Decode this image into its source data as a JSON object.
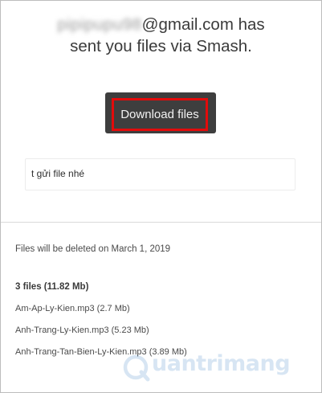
{
  "header": {
    "sender_email_blurred": "pipipupu98",
    "sender_email_domain": "@gmail.com has",
    "line2": "sent you files via Smash."
  },
  "actions": {
    "download_label": "Download files"
  },
  "message": {
    "text": "t gửi file nhé"
  },
  "details": {
    "deletion_notice": "Files will be deleted on March 1, 2019",
    "summary": "3 files (11.82 Mb)",
    "files": [
      "Am-Ap-Ly-Kien.mp3 (2.7 Mb)",
      "Anh-Trang-Ly-Kien.mp3 (5.23 Mb)",
      "Anh-Trang-Tan-Bien-Ly-Kien.mp3 (3.89 Mb)"
    ]
  },
  "watermark": {
    "text": "uantrimang"
  },
  "colors": {
    "button_bg": "#3e3e3e",
    "button_highlight": "#e30b0b",
    "watermark": "#3b82c4"
  }
}
